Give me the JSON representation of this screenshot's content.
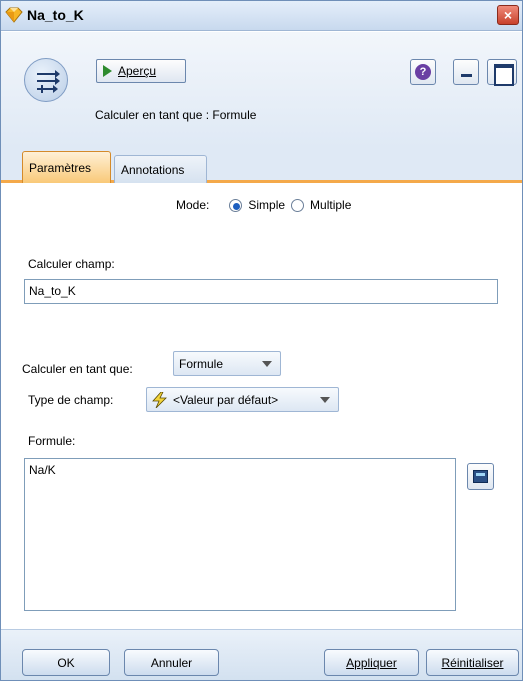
{
  "window": {
    "title": "Na_to_K",
    "close_label": "×"
  },
  "header": {
    "preview_label": "Aperçu",
    "subtitle": "Calculer en tant que : Formule"
  },
  "tabs": [
    {
      "label": "Paramètres",
      "active": true
    },
    {
      "label": "Annotations",
      "active": false
    }
  ],
  "settings": {
    "mode_label": "Mode:",
    "mode_options": [
      {
        "label": "Simple",
        "selected": true
      },
      {
        "label": "Multiple",
        "selected": false
      }
    ],
    "derive_field_label": "Calculer champ:",
    "derive_field_value": "Na_to_K",
    "derive_as_label": "Calculer en tant que:",
    "derive_as_value": "Formule",
    "field_type_label": "Type de champ:",
    "field_type_value": "<Valeur par défaut>",
    "formula_label": "Formule:",
    "formula_value": "Na/K"
  },
  "footer": {
    "ok_label": "OK",
    "cancel_label": "Annuler",
    "apply_label": "Appliquer",
    "reset_label": "Réinitialiser"
  },
  "colors": {
    "active_tab": "#f9c978",
    "tab_underline": "#f4a94a",
    "header_bg": "#dfe9f5",
    "close_button": "#c8412c"
  },
  "icons": [
    "diamond-node-icon",
    "close-icon",
    "derive-node-icon",
    "play-icon",
    "help-icon",
    "minimize-icon",
    "maximize-icon",
    "lightning-icon",
    "expression-builder-icon"
  ]
}
